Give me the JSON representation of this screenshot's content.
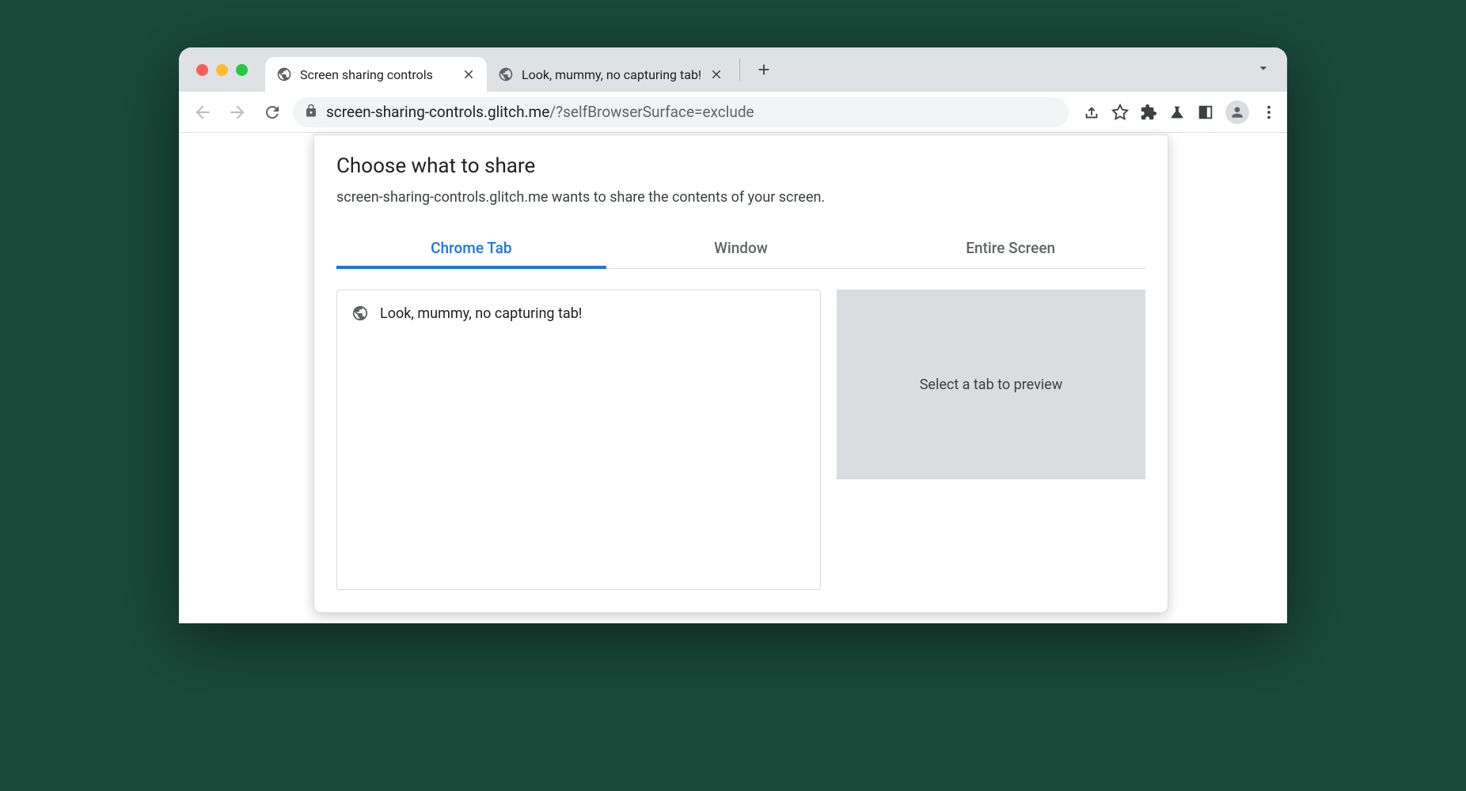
{
  "browser": {
    "tabs": [
      {
        "title": "Screen sharing controls",
        "active": true
      },
      {
        "title": "Look, mummy, no capturing tab!",
        "active": false
      }
    ],
    "url_host": "screen-sharing-controls.glitch.me",
    "url_path": "/?selfBrowserSurface=exclude"
  },
  "share_dialog": {
    "title": "Choose what to share",
    "subtitle": "screen-sharing-controls.glitch.me wants to share the contents of your screen.",
    "tabs": [
      {
        "label": "Chrome Tab",
        "active": true
      },
      {
        "label": "Window",
        "active": false
      },
      {
        "label": "Entire Screen",
        "active": false
      }
    ],
    "tab_list": [
      {
        "title": "Look, mummy, no capturing tab!"
      }
    ],
    "preview_text": "Select a tab to preview"
  },
  "colors": {
    "accent": "#1a73e8",
    "chrome_grey": "#dfe1e5"
  }
}
